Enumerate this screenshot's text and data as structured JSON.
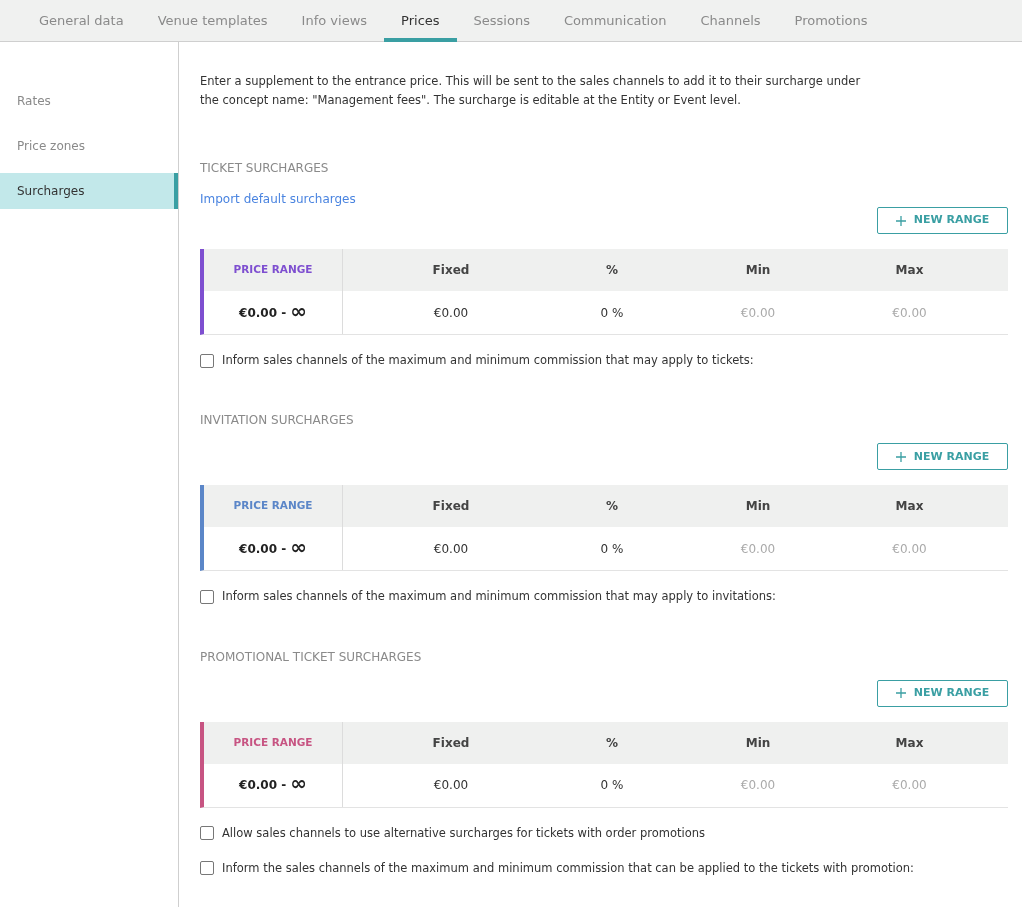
{
  "tabs": [
    {
      "label": "General data",
      "selected": false
    },
    {
      "label": "Venue templates",
      "selected": false
    },
    {
      "label": "Info views",
      "selected": false
    },
    {
      "label": "Prices",
      "selected": true
    },
    {
      "label": "Sessions",
      "selected": false
    },
    {
      "label": "Communication",
      "selected": false
    },
    {
      "label": "Channels",
      "selected": false
    },
    {
      "label": "Promotions",
      "selected": false
    }
  ],
  "sidebar": {
    "items": [
      {
        "label": "Rates",
        "selected": false
      },
      {
        "label": "Price zones",
        "selected": false
      },
      {
        "label": "Surcharges",
        "selected": true
      }
    ]
  },
  "intro": "Enter a supplement to the entrance price. This will be sent to the sales channels to add it to their surcharge under the concept name: \"Management fees\". The surcharge is editable at the Entity or Event level.",
  "sections": [
    {
      "title": "TICKET SURCHARGES",
      "link": "Import default surcharges",
      "button": "NEW RANGE",
      "color": "#7e4fd0",
      "columns": [
        "PRICE RANGE",
        "Fixed",
        "%",
        "Min",
        "Max"
      ],
      "rows": [
        {
          "range_from": "€0.00 -",
          "range_to": "∞",
          "fixed": "€0.00",
          "percent": "0 %",
          "min": "€0.00",
          "max": "€0.00"
        }
      ],
      "checkboxes": [
        {
          "label": "Inform sales channels of the maximum and minimum commission that may apply to tickets:",
          "checked": false
        }
      ]
    },
    {
      "title": "INVITATION SURCHARGES",
      "button": "NEW RANGE",
      "color": "#5b86c8",
      "columns": [
        "PRICE RANGE",
        "Fixed",
        "%",
        "Min",
        "Max"
      ],
      "rows": [
        {
          "range_from": "€0.00 -",
          "range_to": "∞",
          "fixed": "€0.00",
          "percent": "0 %",
          "min": "€0.00",
          "max": "€0.00"
        }
      ],
      "checkboxes": [
        {
          "label": "Inform sales channels of the maximum and minimum commission that may apply to invitations:",
          "checked": false
        }
      ]
    },
    {
      "title": "PROMOTIONAL TICKET SURCHARGES",
      "button": "NEW RANGE",
      "color": "#c75482",
      "columns": [
        "PRICE RANGE",
        "Fixed",
        "%",
        "Min",
        "Max"
      ],
      "rows": [
        {
          "range_from": "€0.00 -",
          "range_to": "∞",
          "fixed": "€0.00",
          "percent": "0 %",
          "min": "€0.00",
          "max": "€0.00"
        }
      ],
      "checkboxes": [
        {
          "label": "Allow sales channels to use alternative surcharges for tickets with order promotions",
          "checked": false
        },
        {
          "label": "Inform the sales channels of the maximum and minimum commission that can be applied to the tickets with promotion:",
          "checked": false
        }
      ]
    }
  ]
}
